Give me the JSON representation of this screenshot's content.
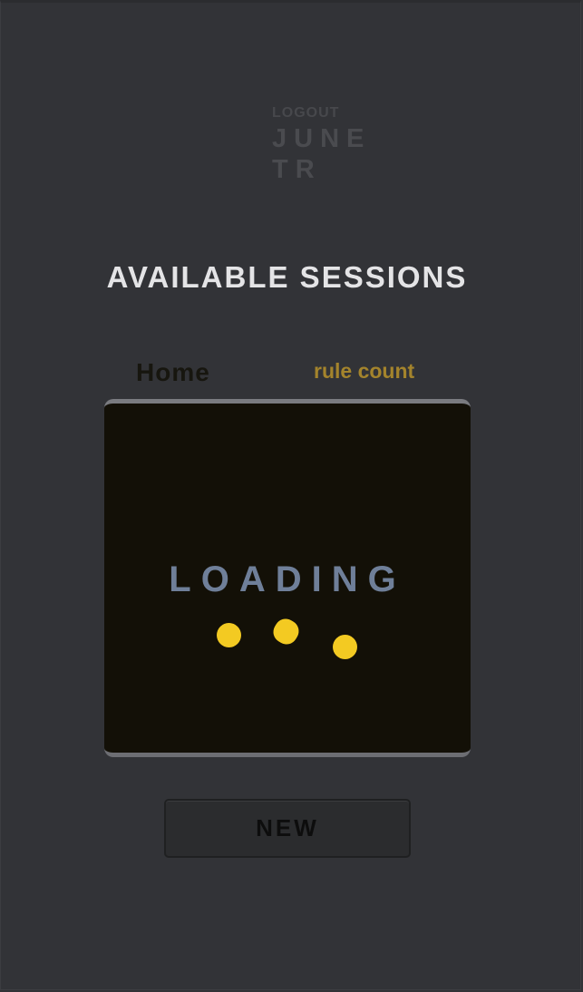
{
  "header": {
    "logout_label": "LOGOUT",
    "user_name_line1": "JUNE",
    "user_name_line2": "TR"
  },
  "page": {
    "title": "AVAILABLE SESSIONS"
  },
  "tabs": [
    {
      "label": "Home"
    },
    {
      "label": "rule count"
    }
  ],
  "sessions_panel": {
    "status_text": "LOADING"
  },
  "actions": {
    "new_label": "NEW"
  },
  "colors": {
    "background": "#323337",
    "panel": "#131007",
    "accent": "#f3ca22",
    "tab_active": "#a4842c",
    "loading_text": "#6f7f99"
  }
}
